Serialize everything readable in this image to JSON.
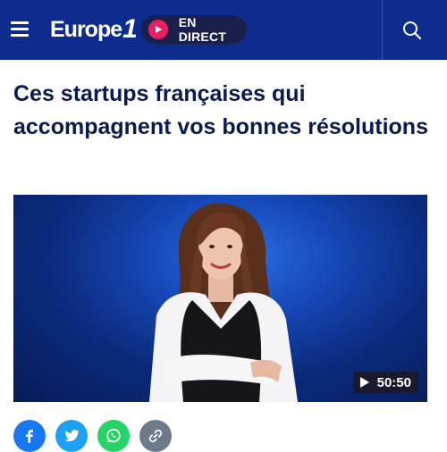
{
  "header": {
    "logo_text": "Europe",
    "logo_number": "1",
    "live_label": "EN DIRECT",
    "background": "#0e2c8e",
    "live_accent": "#ea1e63",
    "menu_icon": "hamburger-menu-icon",
    "search_icon": "search-icon"
  },
  "article": {
    "title": "Ces startups françaises qui accompagnent vos bonnes résolutions"
  },
  "media": {
    "duration": "50:50",
    "play_icon": "play-icon"
  },
  "share": [
    {
      "network": "facebook",
      "icon": "facebook-icon",
      "color": "#1877f2"
    },
    {
      "network": "twitter",
      "icon": "twitter-icon",
      "color": "#1da1f2"
    },
    {
      "network": "whatsapp",
      "icon": "whatsapp-icon",
      "color": "#25d366"
    },
    {
      "network": "copy-link",
      "icon": "link-icon",
      "color": "#6c7a8a"
    }
  ]
}
